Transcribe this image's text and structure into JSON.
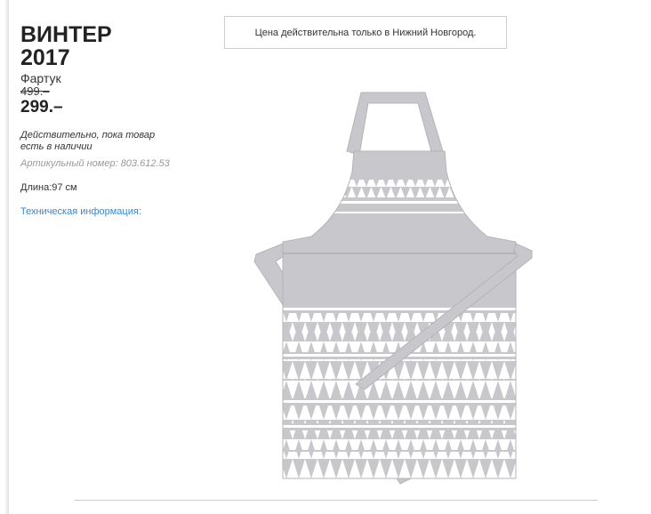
{
  "product": {
    "name_line1": "ВИНТЕР",
    "name_line2": "2017",
    "type": "Фартук",
    "old_price": "499.–",
    "price": "299.–",
    "validity": "Действительно, пока товар есть в наличии",
    "article_label": "Артикульный номер:",
    "article_number": "803.612.53",
    "length": "Длина:97 см",
    "tech_info_link": "Техническая информация:"
  },
  "notice": {
    "text": "Цена действительна только в Нижний Новгород."
  },
  "image": {
    "icon": "apron-product-image",
    "fabric_color": "#c8c8cc",
    "pattern_color": "#ffffff"
  },
  "colors": {
    "link": "#3b87c9"
  }
}
